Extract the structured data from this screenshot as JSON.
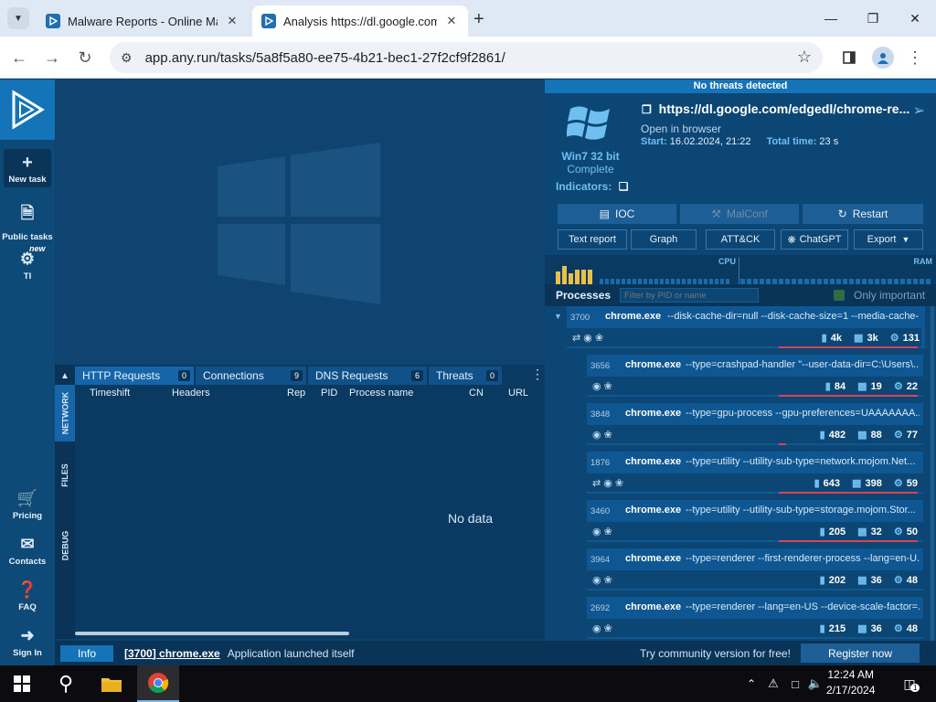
{
  "browser": {
    "tabs": [
      {
        "title": "Malware Reports - Online Malware Analysis",
        "active": false
      },
      {
        "title": "Analysis https://dl.google.com/edgedl",
        "active": true
      }
    ],
    "url": "app.any.run/tasks/5a8f5a80-ee75-4b21-bec1-27f2cf9f2861/"
  },
  "leftnav": {
    "new_task": "New task",
    "public_tasks": "Public tasks",
    "ti_badge": "new",
    "ti": "TI",
    "pricing": "Pricing",
    "contacts": "Contacts",
    "faq": "FAQ",
    "sign_in": "Sign In"
  },
  "netpanel": {
    "side_tabs": [
      "NETWORK",
      "FILES",
      "DEBUG"
    ],
    "tabs": [
      {
        "label": "HTTP Requests",
        "count": "0"
      },
      {
        "label": "Connections",
        "count": "9"
      },
      {
        "label": "DNS Requests",
        "count": "6"
      },
      {
        "label": "Threats",
        "count": "0"
      }
    ],
    "columns": [
      "Timeshift",
      "Headers",
      "Rep",
      "PID",
      "Process name",
      "CN",
      "URL"
    ],
    "empty": "No data"
  },
  "statusbar": {
    "info": "Info",
    "process": "[3700] chrome.exe",
    "message": "Application launched itself",
    "community": "Try community version for free!",
    "register": "Register now"
  },
  "task": {
    "banner": "No threats detected",
    "url": "https://dl.google.com/edgedl/chrome-re...",
    "open_in_browser": "Open in browser",
    "start_label": "Start:",
    "start_value": "16.02.2024, 21:22",
    "total_label": "Total time:",
    "total_value": "23 s",
    "os": "Win7 32 bit",
    "status": "Complete",
    "indicators": "Indicators:",
    "actions": [
      "IOC",
      "MalConf",
      "Restart"
    ],
    "secondary": [
      "Text report",
      "Graph",
      "ATT&CK",
      "ChatGPT",
      "Export"
    ],
    "cpu_label": "CPU",
    "ram_label": "RAM",
    "processes_title": "Processes",
    "filter_placeholder": "Filter by PID or name",
    "only_important": "Only important"
  },
  "processes": [
    {
      "pid": "3700",
      "name": "chrome.exe",
      "cmd": "--disk-cache-dir=null --disk-cache-size=1 --media-cache-...",
      "files": "4k",
      "reg": "3k",
      "mods": "131"
    },
    {
      "pid": "3656",
      "name": "chrome.exe",
      "cmd": "--type=crashpad-handler \"--user-data-dir=C:\\Users\\...",
      "files": "84",
      "reg": "19",
      "mods": "22"
    },
    {
      "pid": "3848",
      "name": "chrome.exe",
      "cmd": "--type=gpu-process --gpu-preferences=UAAAAAAA...",
      "files": "482",
      "reg": "88",
      "mods": "77"
    },
    {
      "pid": "1876",
      "name": "chrome.exe",
      "cmd": "--type=utility --utility-sub-type=network.mojom.Net...",
      "files": "643",
      "reg": "398",
      "mods": "59"
    },
    {
      "pid": "3460",
      "name": "chrome.exe",
      "cmd": "--type=utility --utility-sub-type=storage.mojom.Stor...",
      "files": "205",
      "reg": "32",
      "mods": "50"
    },
    {
      "pid": "3964",
      "name": "chrome.exe",
      "cmd": "--type=renderer --first-renderer-process --lang=en-U...",
      "files": "202",
      "reg": "36",
      "mods": "48"
    },
    {
      "pid": "2692",
      "name": "chrome.exe",
      "cmd": "--type=renderer --lang=en-US --device-scale-factor=...",
      "files": "215",
      "reg": "36",
      "mods": "48"
    }
  ],
  "taskbar": {
    "time": "12:24 AM",
    "date": "2/17/2024",
    "notifications": "1"
  },
  "colors": {
    "accent": "#1573b8",
    "panel": "#0c4675",
    "alert_line": "#d9435a",
    "highlight": "#6fc0f0"
  }
}
